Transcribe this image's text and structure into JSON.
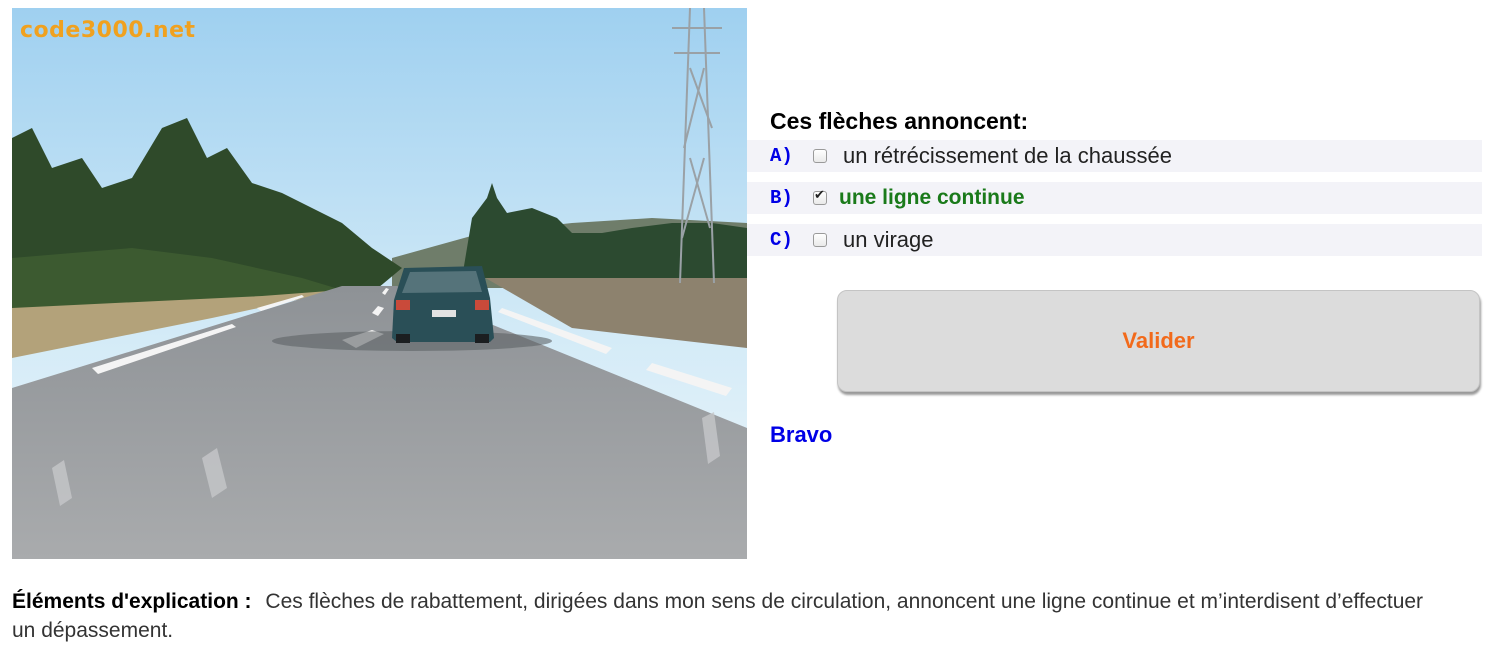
{
  "photo": {
    "watermark": "code3000.net",
    "description_icon": "road-photo"
  },
  "question": {
    "text": "Ces flèches annoncent:"
  },
  "answers": [
    {
      "letter": "A)",
      "text": "un rétrécissement de la chaussée",
      "checked": false
    },
    {
      "letter": "B)",
      "text": "une ligne continue",
      "checked": true
    },
    {
      "letter": "C)",
      "text": "un virage",
      "checked": false
    }
  ],
  "validate": {
    "label": "Valider"
  },
  "feedback": {
    "text": "Bravo"
  },
  "explanation": {
    "label": "Éléments d'explication :",
    "text": "Ces flèches de rabattement, dirigées dans mon sens de circulation, annoncent une ligne continue et m’interdisent d’effectuer un dépassement."
  },
  "colors": {
    "letter": "#0000e6",
    "correct": "#1a7a1a",
    "button_text": "#f26a1b",
    "feedback": "#0000e6",
    "watermark": "#f0a11f"
  }
}
